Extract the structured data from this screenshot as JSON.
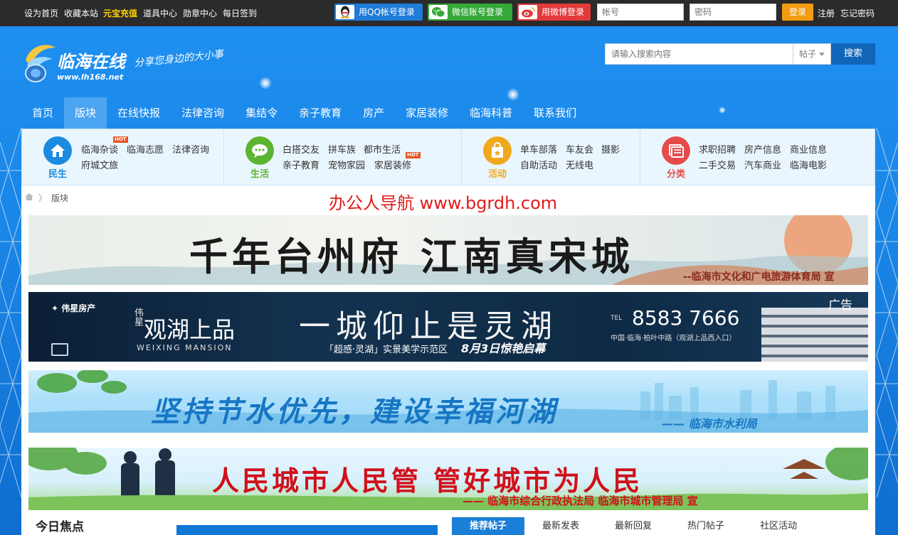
{
  "topbar": {
    "links": [
      "设为首页",
      "收藏本站",
      "元宝充值",
      "道具中心",
      "勋章中心",
      "每日签到"
    ],
    "qq_login": "用QQ帐号登录",
    "wechat_login": "微信账号登录",
    "weibo_login": "用微博登录",
    "account_placeholder": "帐号",
    "password_placeholder": "密码",
    "login": "登录",
    "register": "注册",
    "forgot": "忘记密码"
  },
  "header": {
    "logo_cn": "临海在线",
    "logo_url": "www.lh168.net",
    "slogan": "分享您身边的大小事",
    "search_placeholder": "请输入搜索内容",
    "search_type": "帖子",
    "search_button": "搜索"
  },
  "nav": {
    "items": [
      "首页",
      "版块",
      "在线快报",
      "法律咨询",
      "集结令",
      "亲子教育",
      "房产",
      "家居装修",
      "临海科普",
      "联系我们"
    ],
    "active_index": 1
  },
  "categories": [
    {
      "title": "民生",
      "color": "#1a8be0",
      "icon": "home-icon",
      "row1": [
        "临海杂谈",
        "临海志愿",
        "法律咨询"
      ],
      "row2": [
        "府城文旅"
      ]
    },
    {
      "title": "生活",
      "color": "#5cb531",
      "icon": "chat-icon",
      "row1": [
        "白搭交友",
        "拼车族",
        "都市生活"
      ],
      "row2": [
        "亲子教育",
        "宠物家园",
        "家居装修"
      ]
    },
    {
      "title": "活动",
      "color": "#f0a81c",
      "icon": "bag-icon",
      "row1": [
        "单车部落",
        "车友会",
        "摄影"
      ],
      "row2": [
        "自助活动",
        "无线电"
      ]
    },
    {
      "title": "分类",
      "color": "#e54b4b",
      "icon": "list-icon",
      "row1": [
        "求职招聘",
        "房产信息",
        "商业信息"
      ],
      "row2": [
        "二手交易",
        "汽车商业",
        "临海电影"
      ]
    }
  ],
  "hot_badge": "HOT",
  "breadcrumb": {
    "current": "版块"
  },
  "watermark": "办公人导航 www.bgrdh.com",
  "banners": {
    "b1_title": "千年台州府  江南真宋城",
    "b1_sub": "--临海市文化和广电旅游体育局 宣",
    "b2_brand": "伟星房产",
    "b2_brand_tag": "伟星",
    "b2_project": "观湖上品",
    "b2_project_en": "WEIXING MANSION",
    "b2_slogan": "一城仰止是灵湖",
    "b2_sub1": "「超感·灵湖」实景美学示范区",
    "b2_sub2": "8月3日惊艳启幕",
    "b2_tel_label": "TEL",
    "b2_tel": "8583 7666",
    "b2_addr": "中国·临海·柏叶中路（观湖上品西入口）",
    "b2_ad": "广告",
    "b3_title": "坚持节水优先，建设幸福河湖",
    "b3_sub": "—— 临海市水利局",
    "b4_title": "人民城市人民管  管好城市为人民",
    "b4_sub": "—— 临海市综合行政执法局    临海市城市管理局  宣"
  },
  "bottom": {
    "focus": "今日焦点",
    "tabs": [
      "推荐帖子",
      "最新发表",
      "最新回复",
      "热门帖子",
      "社区活动"
    ]
  }
}
